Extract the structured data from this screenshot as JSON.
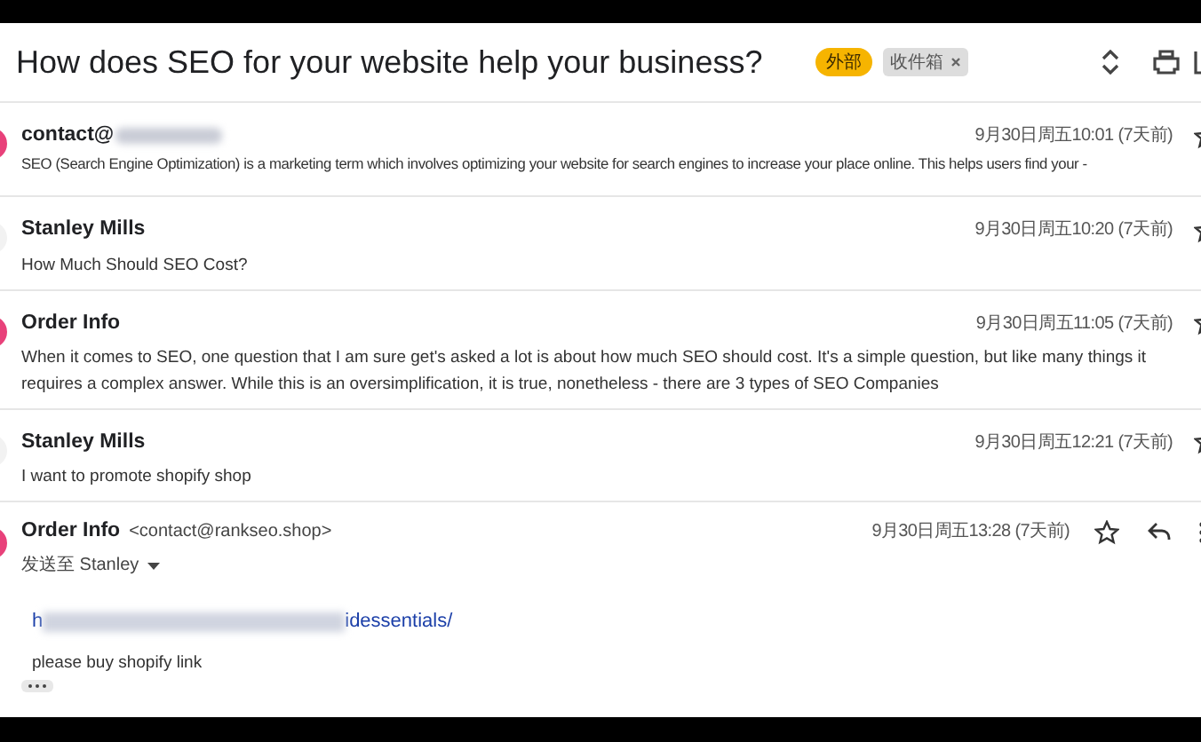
{
  "subject": "How does SEO for your website help your business?",
  "labels": [
    {
      "text": "外部",
      "kind": "external"
    },
    {
      "text": "收件箱",
      "kind": "inbox",
      "removable": true
    }
  ],
  "messages": [
    {
      "kind": "collapsed",
      "color": "#e8417a",
      "sender": "contact@",
      "sender_redacted": true,
      "date": "9月30日周五10:01",
      "age": "(7天前)",
      "snippet": "SEO (Search Engine Optimization) is a marketing term which involves optimizing your website for search engines to increase your place online. This helps users find your -"
    },
    {
      "kind": "collapsed",
      "color": "#f2f2f2",
      "sender": "Stanley Mills",
      "date": "9月30日周五10:20",
      "age": "(7天前)",
      "snippet": "How Much Should SEO Cost?"
    },
    {
      "kind": "collapsed",
      "color": "#e8417a",
      "sender": "Order Info",
      "date": "9月30日周五11:05",
      "age": "(7天前)",
      "snippet": "When it comes to SEO, one question that I am sure get's asked a lot is about how much SEO should cost. It's a simple question, but like many things it requires a complex answer. While this is an oversimplification, it is true, nonetheless - there are 3 types of SEO Companies"
    },
    {
      "kind": "collapsed",
      "color": "#f2f2f2",
      "sender": "Stanley Mills",
      "date": "9月30日周五12:21",
      "age": "(7天前)",
      "snippet": "I want to promote shopify shop"
    },
    {
      "kind": "expanded",
      "color": "#e8417a",
      "sender": "Order Info",
      "email": "<contact@rankseo.shop>",
      "recipient": "发送至 Stanley",
      "date": "9月30日周五13:28",
      "age": "(7天前)",
      "body": [
        {
          "kind": "link",
          "start": "h",
          "end": "idessentials/"
        },
        {
          "kind": "text",
          "text": "please buy shopify link"
        }
      ]
    }
  ]
}
